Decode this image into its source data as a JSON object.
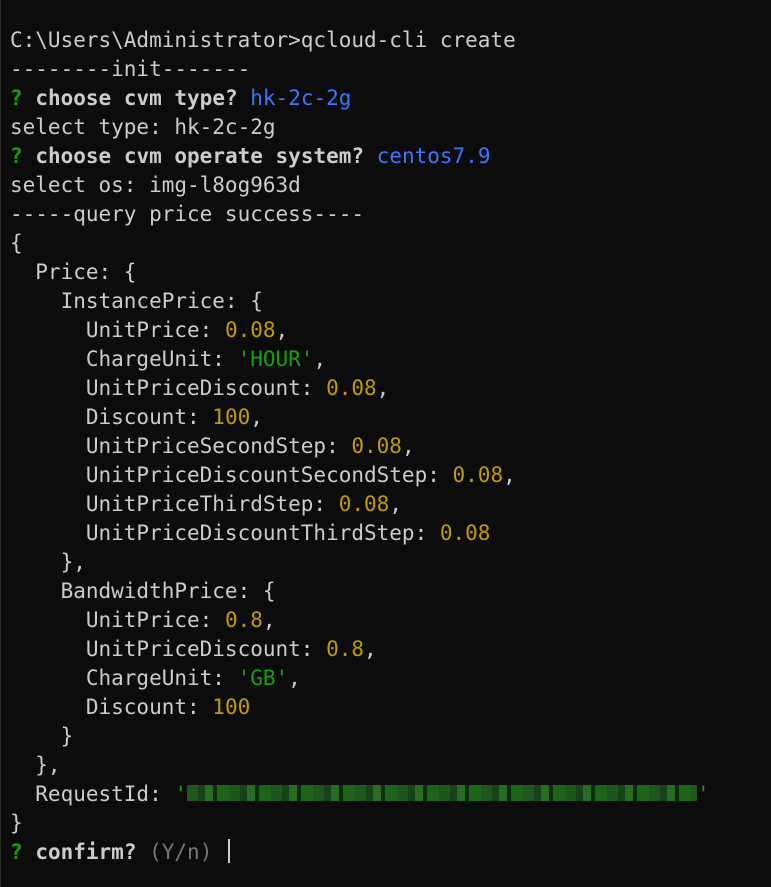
{
  "terminal": {
    "prompt_line": "C:\\Users\\Administrator>qcloud-cli create",
    "init_line": "--------init-------",
    "q1_mark": "?",
    "q1_text": "choose cvm type?",
    "q1_answer": "hk-2c-2g",
    "select_type": "select type: hk-2c-2g",
    "q2_mark": "?",
    "q2_text": "choose cvm operate system?",
    "q2_answer": "centos7.9",
    "select_os": "select os: img-l8og963d",
    "query_success": "-----query price success----",
    "open_brace": "{",
    "price_key": "  Price: {",
    "instance_price_key": "    InstancePrice: {",
    "instance_price": [
      {
        "key": "      UnitPrice: ",
        "value": "0.08",
        "type": "num",
        "suffix": ","
      },
      {
        "key": "      ChargeUnit: ",
        "value": "'HOUR'",
        "type": "str",
        "suffix": ","
      },
      {
        "key": "      UnitPriceDiscount: ",
        "value": "0.08",
        "type": "num",
        "suffix": ","
      },
      {
        "key": "      Discount: ",
        "value": "100",
        "type": "num",
        "suffix": ","
      },
      {
        "key": "      UnitPriceSecondStep: ",
        "value": "0.08",
        "type": "num",
        "suffix": ","
      },
      {
        "key": "      UnitPriceDiscountSecondStep: ",
        "value": "0.08",
        "type": "num",
        "suffix": ","
      },
      {
        "key": "      UnitPriceThirdStep: ",
        "value": "0.08",
        "type": "num",
        "suffix": ","
      },
      {
        "key": "      UnitPriceDiscountThirdStep: ",
        "value": "0.08",
        "type": "num",
        "suffix": ""
      }
    ],
    "instance_close": "    },",
    "bandwidth_price_key": "    BandwidthPrice: {",
    "bandwidth_price": [
      {
        "key": "      UnitPrice: ",
        "value": "0.8",
        "type": "num",
        "suffix": ","
      },
      {
        "key": "      UnitPriceDiscount: ",
        "value": "0.8",
        "type": "num",
        "suffix": ","
      },
      {
        "key": "      ChargeUnit: ",
        "value": "'GB'",
        "type": "str",
        "suffix": ","
      },
      {
        "key": "      Discount: ",
        "value": "100",
        "type": "num",
        "suffix": ""
      }
    ],
    "bandwidth_close": "    }",
    "price_close": "  },",
    "request_id_key": "  RequestId: ",
    "request_id_open_quote": "'",
    "request_id_close_quote": "'",
    "close_brace": "}",
    "confirm_mark": "?",
    "confirm_text": "confirm?",
    "confirm_hint": "(Y/n)"
  },
  "colors": {
    "background": "#0c0c0c",
    "foreground": "#cccccc",
    "question_mark": "#13a10e",
    "answer": "#3b78ff",
    "number": "#c19c00",
    "string": "#13a10e",
    "hint": "#767676"
  }
}
